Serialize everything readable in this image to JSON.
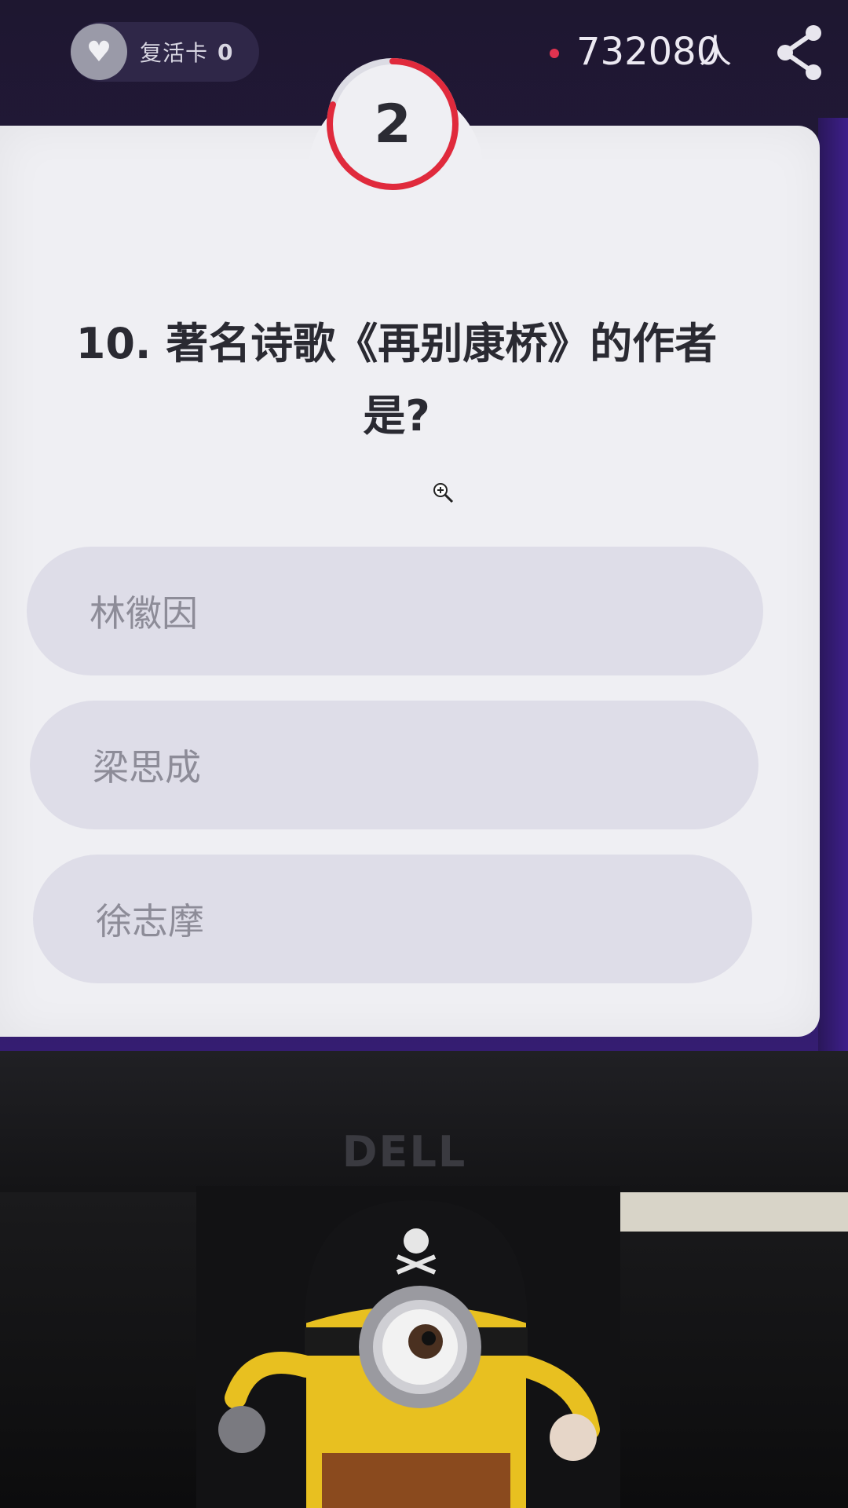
{
  "top_bar": {
    "revive_label": "复活卡",
    "revive_count": "0",
    "viewer_count": "732080",
    "viewer_unit": "人",
    "icons": {
      "revive": "heart-icon",
      "share": "share-icon",
      "live": "live-dot-icon"
    }
  },
  "timer": {
    "value": "2",
    "remaining_fraction": 0.8
  },
  "question": {
    "text_line1": "10. 著名诗歌《再别康桥》的作者",
    "text_line2": "是?"
  },
  "options": [
    {
      "label": "林徽因"
    },
    {
      "label": "梁思成"
    },
    {
      "label": "徐志摩"
    }
  ],
  "monitor": {
    "brand": "DELL"
  },
  "colors": {
    "background": "#2a1a4e",
    "card": "#efeff3",
    "option": "#dedde8",
    "timer_ring": "#e02a3c",
    "live_dot": "#e03350"
  }
}
